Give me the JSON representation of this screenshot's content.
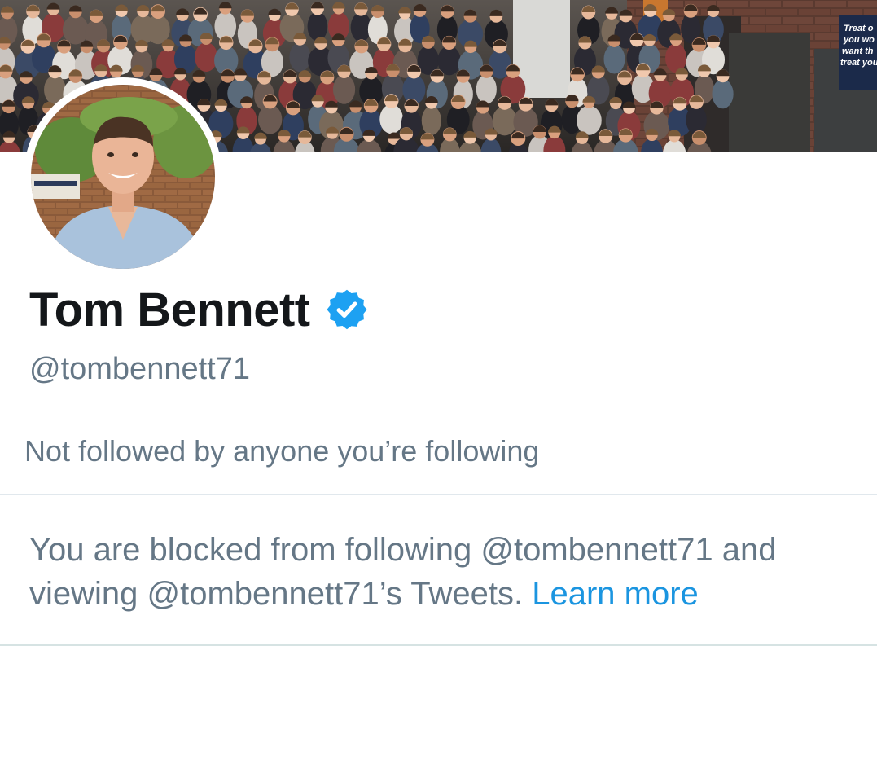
{
  "profile": {
    "display_name": "Tom Bennett",
    "verified": true,
    "verified_icon": "verified-badge-icon",
    "handle": "@tombennett71",
    "followers_you_know": "Not followed by anyone you’re following"
  },
  "blocked_notice": {
    "text": "You are blocked from following @tombennett71 and viewing @tombennett71’s Tweets. ",
    "link_label": "Learn more"
  },
  "banner": {
    "sign_lines": [
      "Treat o",
      "you wo",
      "want th",
      "treat you"
    ]
  },
  "colors": {
    "name_text": "#14171a",
    "secondary_text": "#657786",
    "link": "#1b95e0",
    "verified_badge": "#1da1f2",
    "divider": "#e1e8ed"
  }
}
